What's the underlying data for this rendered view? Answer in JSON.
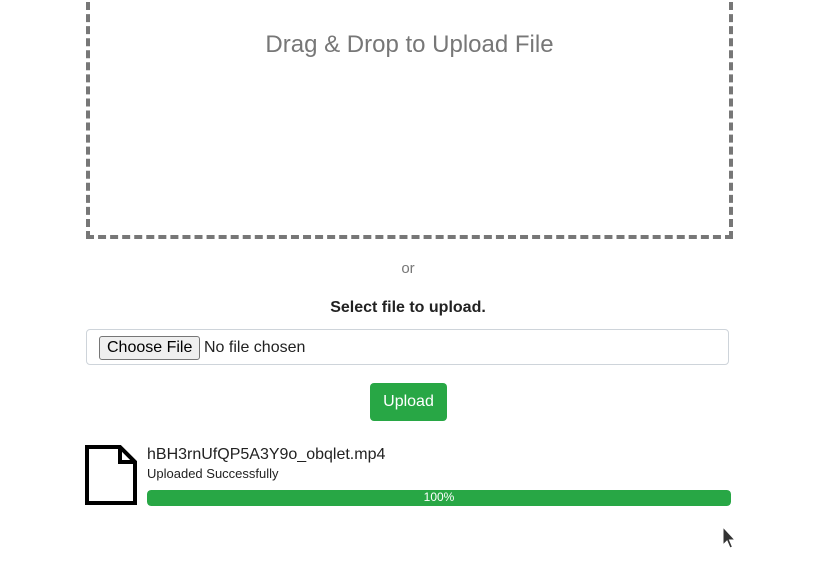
{
  "dropzone": {
    "text": "Drag & Drop to Upload File"
  },
  "separator": {
    "text": "or"
  },
  "select": {
    "label": "Select file to upload.",
    "choose_button": "Choose File",
    "no_file_text": "No file chosen"
  },
  "upload_button": {
    "label": "Upload"
  },
  "uploaded_file": {
    "icon": "file-icon",
    "name": "hBH3rnUfQP5A3Y9o_obqlet.mp4",
    "status": "Uploaded Successfully",
    "progress_value": 100,
    "progress_label": "100%"
  },
  "colors": {
    "success": "#28a745",
    "muted_text": "#777777",
    "dropzone_border": "#777777"
  }
}
